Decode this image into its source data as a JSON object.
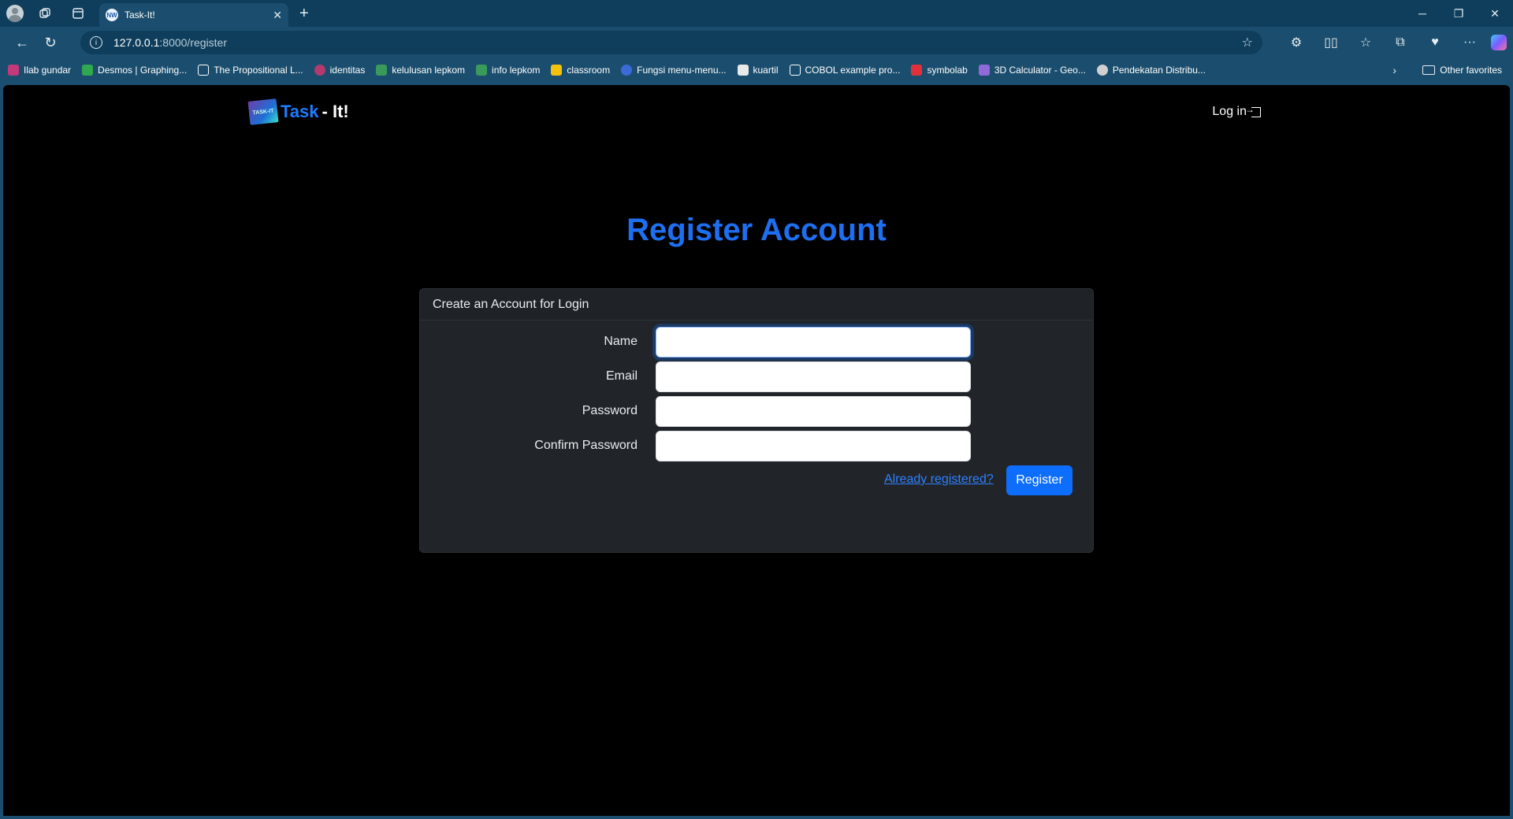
{
  "browser": {
    "tab": {
      "favicon_text": "NW",
      "title": "Task-It!"
    },
    "url": {
      "host": "127.0.0.1",
      "path": ":8000/register"
    },
    "bookmarks": [
      {
        "label": "Ilab gundar",
        "color": "#c23a7a"
      },
      {
        "label": "Desmos | Graphing...",
        "color": "#2fa84f"
      },
      {
        "label": "The Propositional L...",
        "color": "#ffffff"
      },
      {
        "label": "identitas",
        "color": "#b33a6e"
      },
      {
        "label": "kelulusan lepkom",
        "color": "#3a9a5a"
      },
      {
        "label": "info lepkom",
        "color": "#3a9a5a"
      },
      {
        "label": "classroom",
        "color": "#f4c20d"
      },
      {
        "label": "Fungsi menu-menu...",
        "color": "#3b6bd6"
      },
      {
        "label": "kuartil",
        "color": "#e9e9e9"
      },
      {
        "label": "COBOL example pro...",
        "color": "#ffffff"
      },
      {
        "label": "symbolab",
        "color": "#e0313a"
      },
      {
        "label": "3D Calculator - Geo...",
        "color": "#8f6ad8"
      },
      {
        "label": "Pendekatan Distribu...",
        "color": "#d0d0d0"
      }
    ],
    "other_favorites": "Other favorites"
  },
  "app": {
    "brand_logo_text": "TASK-IT",
    "brand_a": "Task",
    "brand_b": "- It!",
    "login": "Log in",
    "heading": "Register Account",
    "card_title": "Create an Account for Login",
    "fields": {
      "name": {
        "label": "Name",
        "value": ""
      },
      "email": {
        "label": "Email",
        "value": ""
      },
      "password": {
        "label": "Password",
        "value": ""
      },
      "confirm": {
        "label": "Confirm Password",
        "value": ""
      }
    },
    "already_registered": "Already registered?",
    "register_button": "Register"
  },
  "colors": {
    "accent": "#0d6efd",
    "heading": "#1e6ff0",
    "chrome": "#1b4e6e"
  }
}
